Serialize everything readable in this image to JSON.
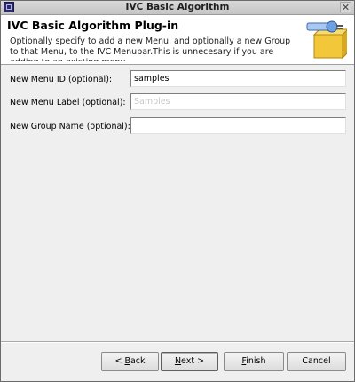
{
  "window": {
    "title": "IVC Basic Algorithm",
    "close_glyph": "✕"
  },
  "banner": {
    "title": "IVC Basic Algorithm Plug-in",
    "description": "Optionally specify to add a new Menu, and optionally a new Group to that Menu, to the IVC Menubar.This is unnecesary if you are adding to an existing menu.",
    "icon": "plug-in-wizard-icon"
  },
  "form": {
    "menu_id": {
      "label": "New Menu ID (optional):",
      "value": "samples"
    },
    "menu_label": {
      "label": "New Menu Label (optional):",
      "value": "Samples"
    },
    "group_name": {
      "label": "New Group Name (optional):",
      "value": ""
    }
  },
  "buttons": {
    "back": {
      "prefix": "< ",
      "mnemonic": "B",
      "rest": "ack"
    },
    "next": {
      "mnemonic": "N",
      "rest": "ext >"
    },
    "finish": {
      "mnemonic": "F",
      "rest": "inish"
    },
    "cancel": {
      "label": "Cancel"
    }
  },
  "colors": {
    "banner_bg": "#ffffff",
    "dialog_bg": "#efefef",
    "icon_accent": "#f0c020"
  }
}
